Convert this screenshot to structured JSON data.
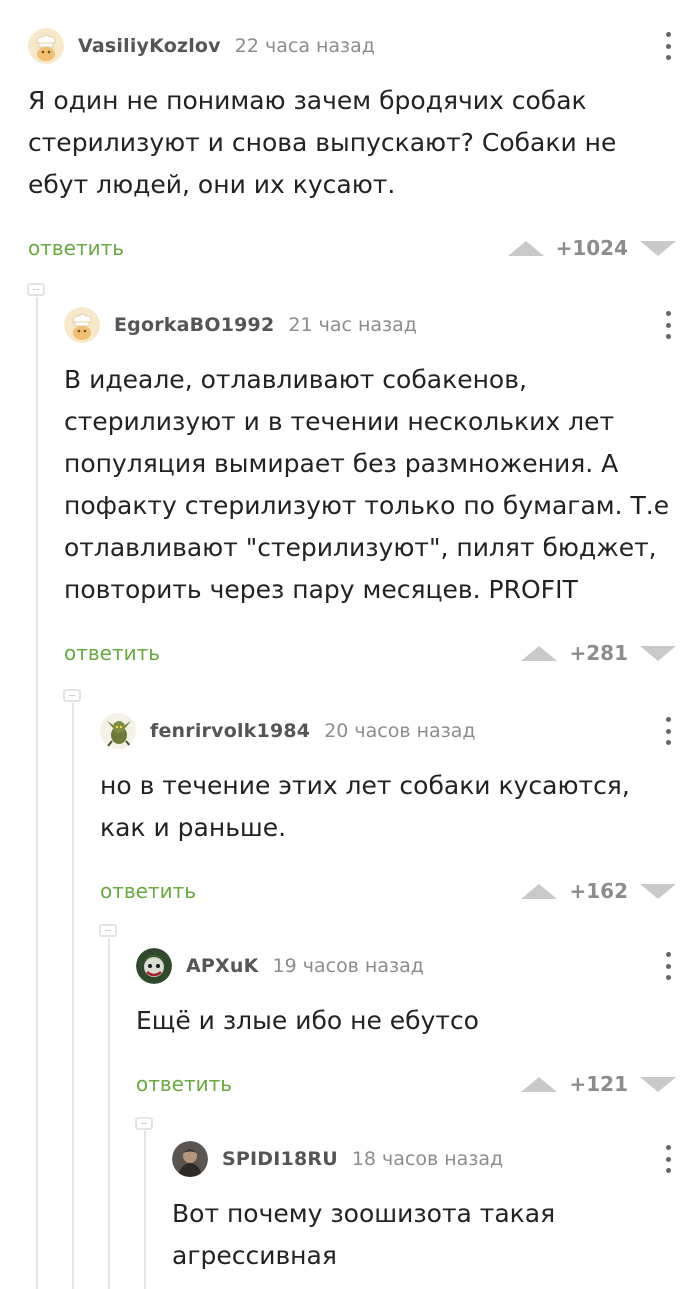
{
  "comments": [
    {
      "author": "VasiliyKozlov",
      "time": "22 часа назад",
      "text": "Я один не понимаю зачем бродячих собак стерилизуют и снова выпускают? Собаки не ебут людей, они их кусают.",
      "reply_label": "ответить",
      "rating": "+1024",
      "avatar": "default-chef-avatar"
    },
    {
      "author": "EgorkaBO1992",
      "time": "21 час назад",
      "text": "В идеале, отлавливают собакенов, стерилизуют и в течении нескольких лет популяция вымирает без размножения. А пофакту стерилизуют только по бумагам. Т.е отлавливают \"стерилизуют\", пилят бюджет, повторить через пару месяцев. PROFIT",
      "reply_label": "ответить",
      "rating": "+281",
      "avatar": "default-chef-avatar"
    },
    {
      "author": "fenrirvolk1984",
      "time": "20 часов назад",
      "text": "но в течение этих лет собаки кусаются, как и раньше.",
      "reply_label": "ответить",
      "rating": "+162",
      "avatar": "goblin-avatar"
    },
    {
      "author": "APXuK",
      "time": "19 часов назад",
      "text": "Ещё и злые ибо не ебутсо",
      "reply_label": "ответить",
      "rating": "+121",
      "avatar": "joker-avatar"
    },
    {
      "author": "SPIDI18RU",
      "time": "18 часов назад",
      "text": "Вот почему зоошизота такая агрессивная",
      "avatar": "photo-avatar"
    }
  ],
  "colors": {
    "reply": "#6aa840",
    "thread_line": "#e3e3e3",
    "vote_arrow": "#c9c9c9"
  }
}
